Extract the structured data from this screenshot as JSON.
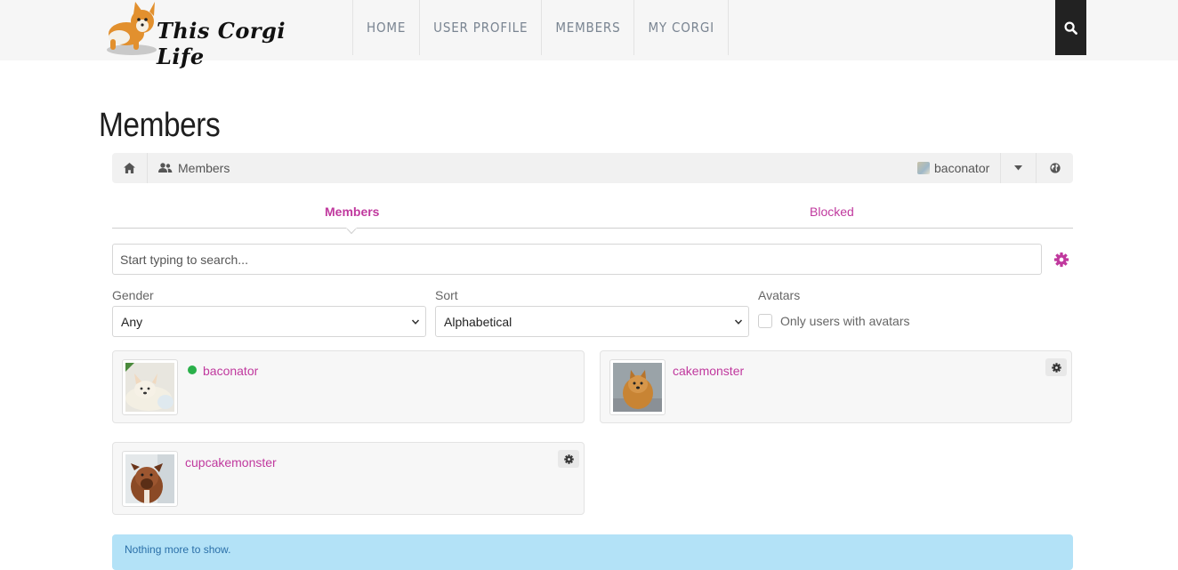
{
  "header": {
    "logo_text": "This Corgi Life",
    "nav": [
      "HOME",
      "USER PROFILE",
      "MEMBERS",
      "MY CORGI"
    ],
    "search_icon": "search-icon"
  },
  "page": {
    "title": "Members"
  },
  "breadcrumb": {
    "home_icon": "home-icon",
    "current": "Members",
    "user": "baconator"
  },
  "tabs": [
    {
      "label": "Members",
      "active": true
    },
    {
      "label": "Blocked",
      "active": false
    }
  ],
  "search": {
    "placeholder": "Start typing to search..."
  },
  "filters": {
    "gender": {
      "label": "Gender",
      "value": "Any"
    },
    "sort": {
      "label": "Sort",
      "value": "Alphabetical"
    },
    "avatars": {
      "label": "Avatars",
      "checkbox_label": "Only users with avatars",
      "checked": false
    }
  },
  "members": [
    {
      "name": "baconator",
      "online": true
    },
    {
      "name": "cakemonster",
      "online": false
    },
    {
      "name": "cupcakemonster",
      "online": false
    }
  ],
  "footer_notice": "Nothing more to show.",
  "colors": {
    "accent": "#c0399e",
    "online": "#2ab04a",
    "info_bg": "#b3e2f7"
  }
}
